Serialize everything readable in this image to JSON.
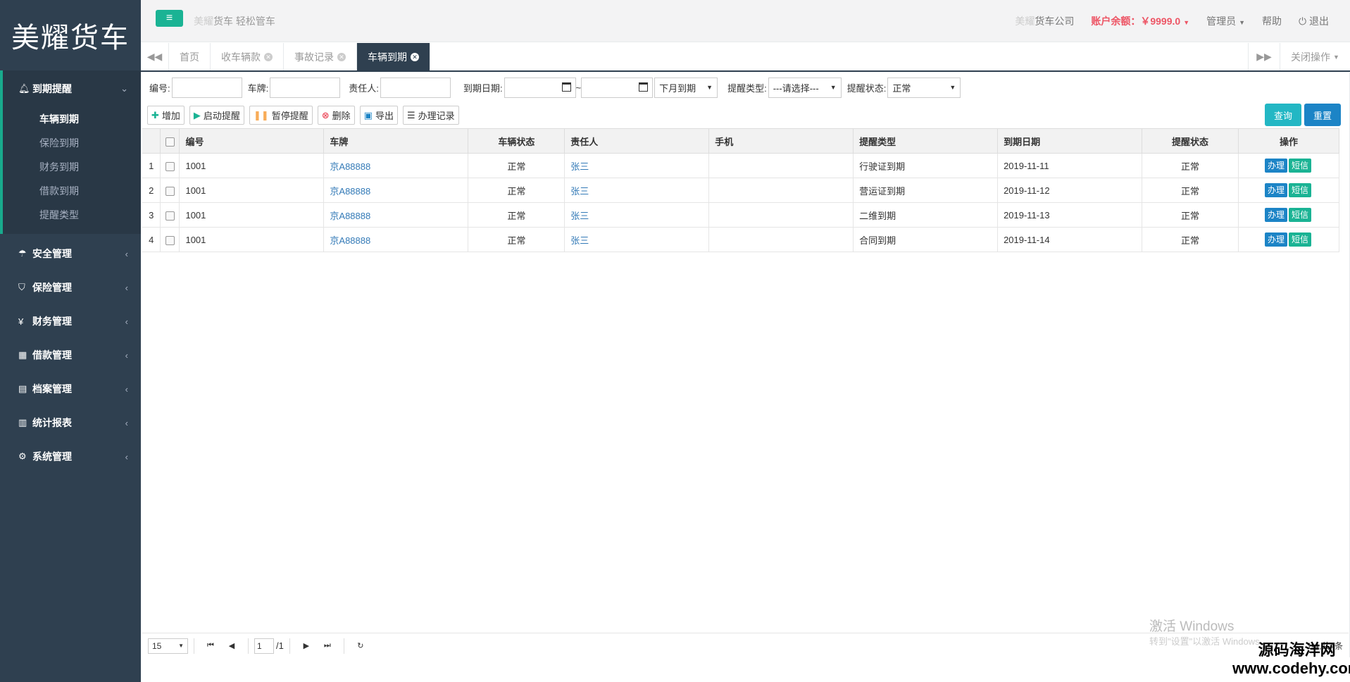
{
  "app": {
    "logo": "美耀货车",
    "slogan_brand": "美耀",
    "slogan_rest": "货车 轻松管车"
  },
  "header": {
    "company_dim": "美耀",
    "company": "货车公司",
    "balance": "账户余额：￥9999.0",
    "admin": "管理员",
    "help": "帮助",
    "logout": "退出"
  },
  "sidebar": {
    "groups": [
      {
        "label": "到期提醒",
        "icon": "bell-icon",
        "expanded": true,
        "items": [
          "车辆到期",
          "保险到期",
          "财务到期",
          "借款到期",
          "提醒类型"
        ]
      },
      {
        "label": "安全管理",
        "icon": "umbrella-icon"
      },
      {
        "label": "保险管理",
        "icon": "shield-icon"
      },
      {
        "label": "财务管理",
        "icon": "yen-icon"
      },
      {
        "label": "借款管理",
        "icon": "calculator-icon"
      },
      {
        "label": "档案管理",
        "icon": "file-icon"
      },
      {
        "label": "统计报表",
        "icon": "bar-chart-icon"
      },
      {
        "label": "系统管理",
        "icon": "gear-icon"
      }
    ]
  },
  "tabs": {
    "items": [
      "首页",
      "收车辆款",
      "事故记录",
      "车辆到期"
    ],
    "close_ops": "关闭操作"
  },
  "filters": {
    "code_label": "编号:",
    "plate_label": "车牌:",
    "person_label": "责任人:",
    "date_label": "到期日期:",
    "date_sep": "~",
    "month_select": "下月到期",
    "type_label": "提醒类型:",
    "type_select": "---请选择---",
    "status_label": "提醒状态:",
    "status_select": "正常"
  },
  "toolbar": {
    "add": "增加",
    "start": "启动提醒",
    "pause": "暂停提醒",
    "delete": "删除",
    "export": "导出",
    "records": "办理记录",
    "query": "查询",
    "reset": "重置"
  },
  "table": {
    "headers": [
      "编号",
      "车牌",
      "车辆状态",
      "责任人",
      "手机",
      "提醒类型",
      "到期日期",
      "提醒状态",
      "操作"
    ],
    "rows": [
      {
        "n": "1",
        "code": "1001",
        "plate": "京A88888",
        "vstatus": "正常",
        "person": "张三",
        "phone": "",
        "type": "行驶证到期",
        "date": "2019-11-11",
        "status": "正常"
      },
      {
        "n": "2",
        "code": "1001",
        "plate": "京A88888",
        "vstatus": "正常",
        "person": "张三",
        "phone": "",
        "type": "营运证到期",
        "date": "2019-11-12",
        "status": "正常"
      },
      {
        "n": "3",
        "code": "1001",
        "plate": "京A88888",
        "vstatus": "正常",
        "person": "张三",
        "phone": "",
        "type": "二维到期",
        "date": "2019-11-13",
        "status": "正常"
      },
      {
        "n": "4",
        "code": "1001",
        "plate": "京A88888",
        "vstatus": "正常",
        "person": "张三",
        "phone": "",
        "type": "合同到期",
        "date": "2019-11-14",
        "status": "正常"
      }
    ],
    "action_handle": "办理",
    "action_sms": "短信"
  },
  "pager": {
    "page_size": "15",
    "page": "1",
    "total_pages": "/1",
    "info": "1-4,共4条"
  },
  "watermark": {
    "line1": "激活 Windows",
    "line2": "转到\"设置\"以激活 Windows。",
    "brand1": "源码海洋网",
    "brand2": "www.codehy.com"
  },
  "colors": {
    "sidebar_bg": "#2f4050",
    "accent": "#1ab394",
    "query_btn": "#23b7c4",
    "reset_btn": "#1c84c6",
    "handle_btn": "#1c84c6",
    "sms_btn": "#1ab394",
    "balance": "#ed5565"
  }
}
